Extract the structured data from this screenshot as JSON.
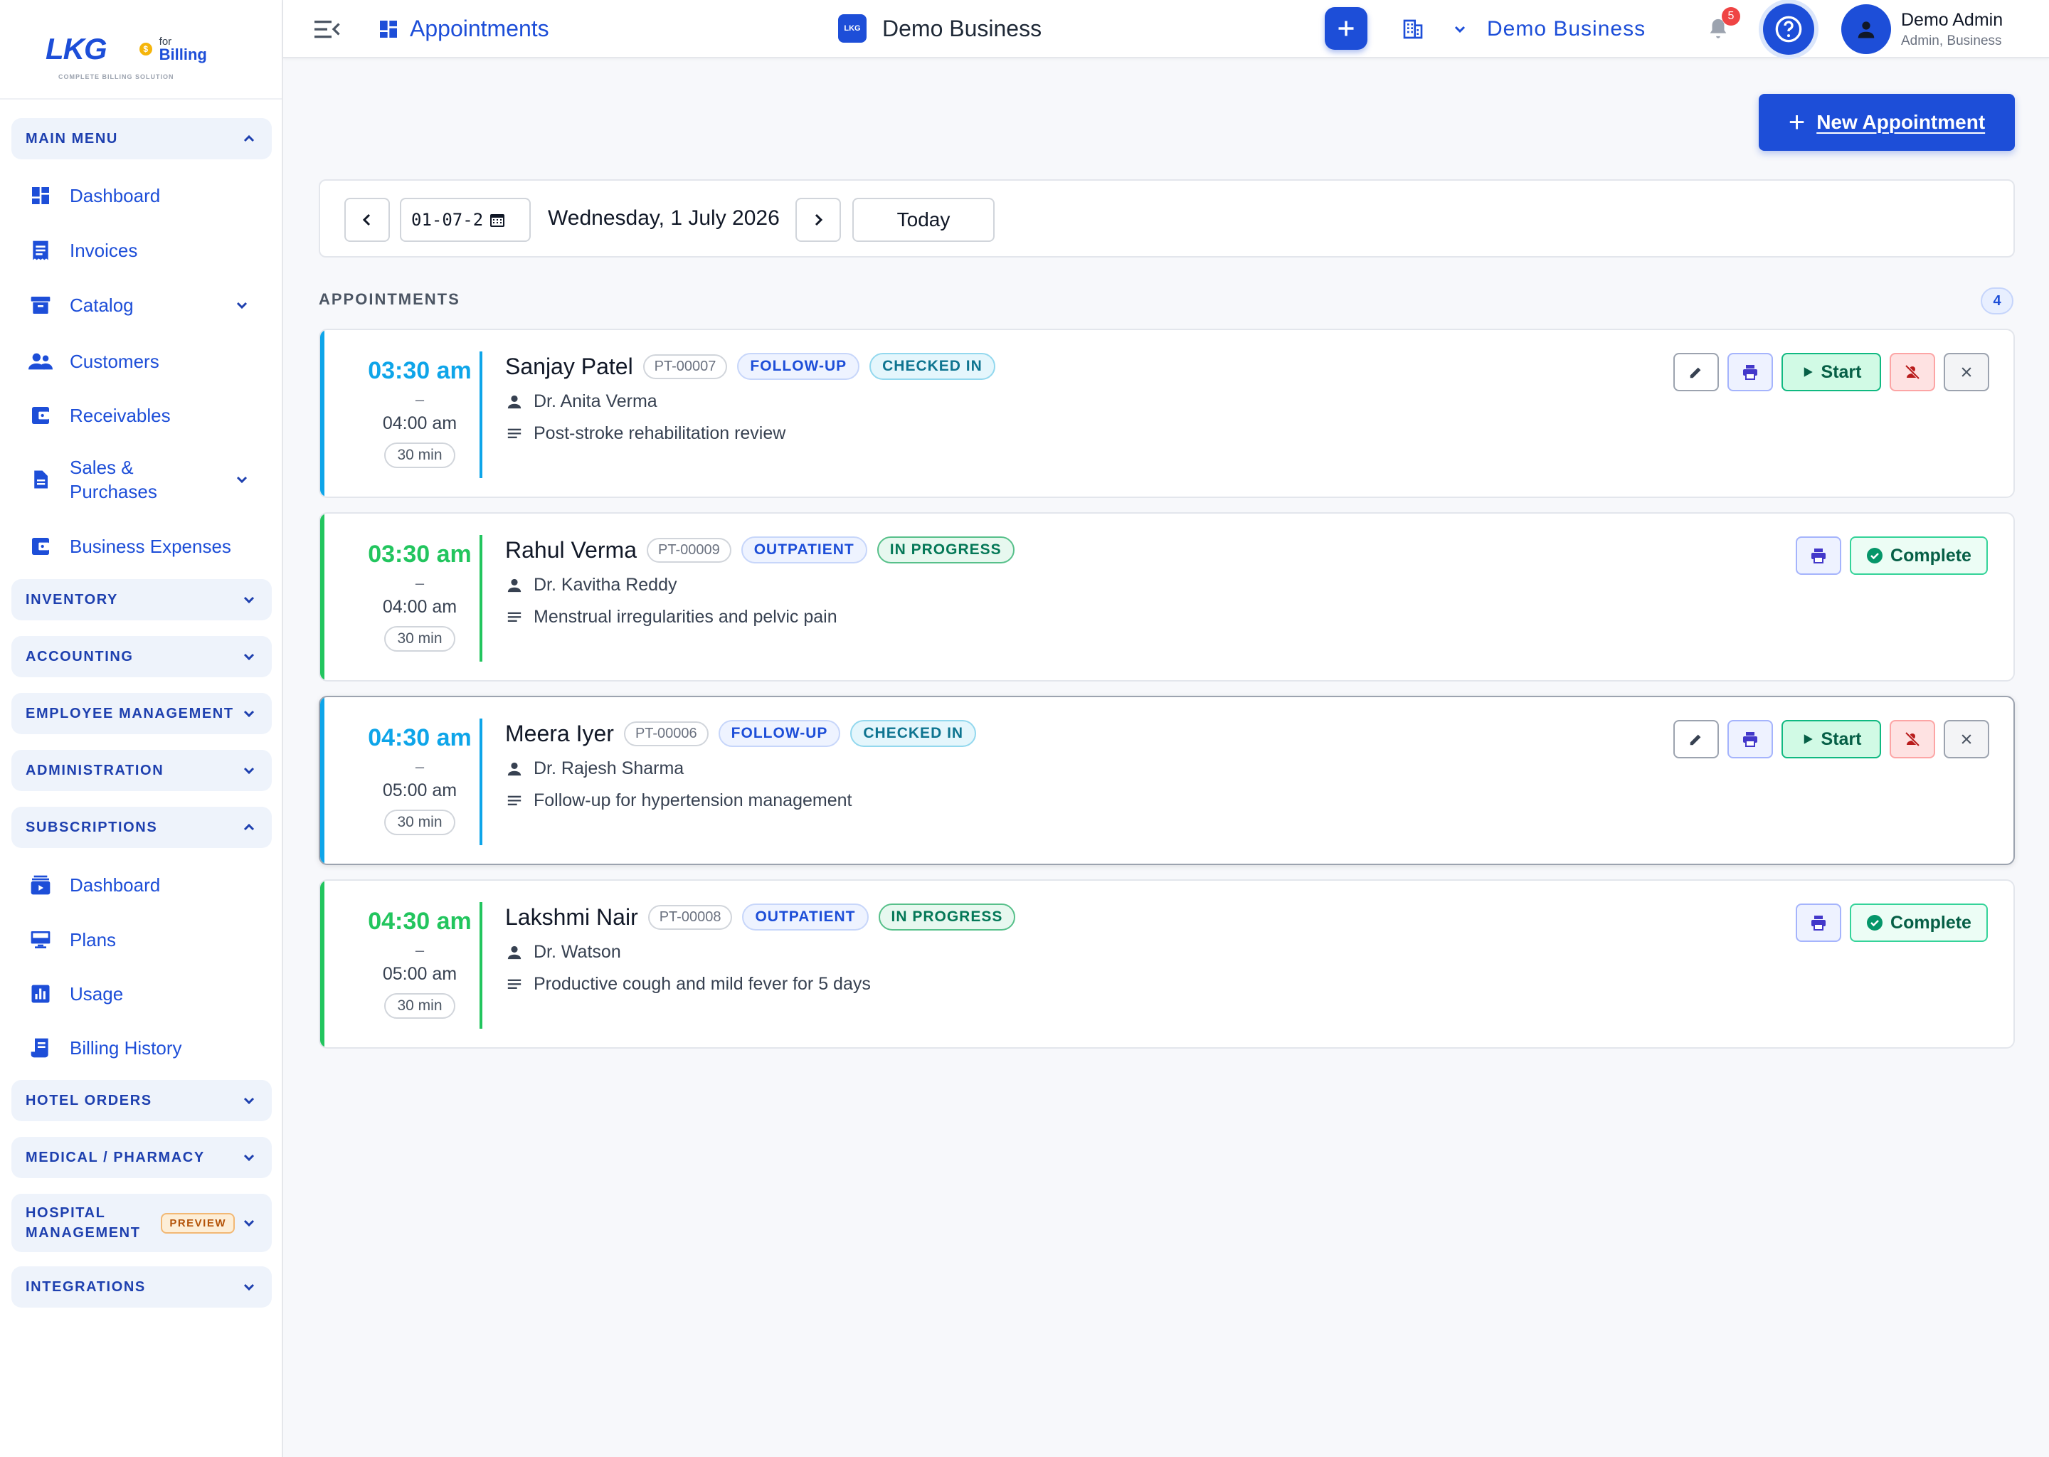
{
  "brand": {
    "name": "LKG",
    "coin": "$",
    "for": "for",
    "billing": "Billing",
    "tagline": "COMPLETE BILLING SOLUTION"
  },
  "sidebar": {
    "main_menu": "MAIN MENU",
    "main_items": [
      {
        "label": "Dashboard",
        "icon": "dashboard-icon"
      },
      {
        "label": "Invoices",
        "icon": "invoice-icon"
      },
      {
        "label": "Catalog",
        "icon": "catalog-icon"
      },
      {
        "label": "Customers",
        "icon": "customers-icon"
      },
      {
        "label": "Receivables",
        "icon": "wallet-icon"
      },
      {
        "label": "Sales &",
        "label2": "Purchases",
        "icon": "document-icon"
      },
      {
        "label": "Business Expenses",
        "icon": "wallet-icon"
      }
    ],
    "inventory": "INVENTORY",
    "accounting": "ACCOUNTING",
    "employee": "EMPLOYEE MANAGEMENT",
    "administration": "ADMINISTRATION",
    "subscriptions": "SUBSCRIPTIONS",
    "sub_items": [
      {
        "label": "Dashboard",
        "icon": "subscription-dashboard-icon"
      },
      {
        "label": "Plans",
        "icon": "plans-icon"
      },
      {
        "label": "Usage",
        "icon": "usage-chart-icon"
      },
      {
        "label": "Billing History",
        "icon": "receipt-icon"
      }
    ],
    "hotel": "HOTEL ORDERS",
    "medical": "MEDICAL / PHARMACY",
    "hospital": "HOSPITAL",
    "hospital2": "MANAGEMENT",
    "preview": "PREVIEW",
    "integrations": "INTEGRATIONS"
  },
  "topbar": {
    "page_title": "Appointments",
    "business_title": "Demo Business",
    "business_switch": "Demo Business",
    "notifications": "5",
    "user_name": "Demo Admin",
    "user_role": "Admin, Business"
  },
  "main": {
    "new_button": "New Appointment",
    "date_value": "01-07-2",
    "date_label": "Wednesday, 1 July 2026",
    "today": "Today",
    "section_label": "APPOINTMENTS",
    "count": "4"
  },
  "colors": {
    "primary": "#1d4ed8",
    "checked_in": "#0ea5e9",
    "in_progress": "#22c55e"
  },
  "appointments": [
    {
      "start": "03:30 am",
      "dash": "–",
      "end": "04:00 am",
      "duration": "30 min",
      "name": "Sanjay Patel",
      "pid": "PT-00007",
      "type": "FOLLOW-UP",
      "status": "CHECKED IN",
      "doctor": "Dr. Anita Verma",
      "note": "Post-stroke rehabilitation review",
      "start_label": "Start"
    },
    {
      "start": "03:30 am",
      "dash": "–",
      "end": "04:00 am",
      "duration": "30 min",
      "name": "Rahul Verma",
      "pid": "PT-00009",
      "type": "OUTPATIENT",
      "status": "IN PROGRESS",
      "doctor": "Dr. Kavitha Reddy",
      "note": "Menstrual irregularities and pelvic pain",
      "complete_label": "Complete"
    },
    {
      "start": "04:30 am",
      "dash": "–",
      "end": "05:00 am",
      "duration": "30 min",
      "name": "Meera Iyer",
      "pid": "PT-00006",
      "type": "FOLLOW-UP",
      "status": "CHECKED IN",
      "doctor": "Dr. Rajesh Sharma",
      "note": "Follow-up for hypertension management",
      "start_label": "Start"
    },
    {
      "start": "04:30 am",
      "dash": "–",
      "end": "05:00 am",
      "duration": "30 min",
      "name": "Lakshmi Nair",
      "pid": "PT-00008",
      "type": "OUTPATIENT",
      "status": "IN PROGRESS",
      "doctor": "Dr. Watson",
      "note": "Productive cough and mild fever for 5 days",
      "complete_label": "Complete"
    }
  ]
}
